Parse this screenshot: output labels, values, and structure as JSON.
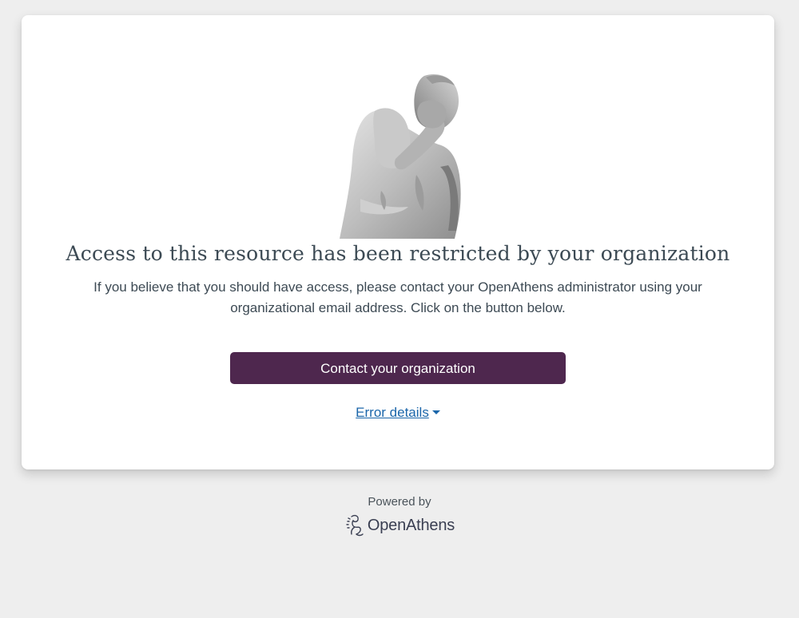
{
  "card": {
    "image": "statue-facepalm-image",
    "title": "Access to this resource has been restricted by your organization",
    "description_line1": "If you believe that you should have access, please contact your OpenAthens administrator using your",
    "description_line2": "organizational email address. Click on the button below.",
    "contact_button_label": "Contact your organization",
    "error_details_label": "Error details",
    "error_details_icon": "caret-down-icon"
  },
  "footer": {
    "powered_by": "Powered by",
    "brand_name": "OpenAthens",
    "brand_icon": "openathens-logo-icon"
  },
  "colors": {
    "page_background": "#eeeeee",
    "card_background": "#ffffff",
    "button_background": "#4e274e",
    "link": "#1b66aa",
    "text": "#3c4a54"
  }
}
